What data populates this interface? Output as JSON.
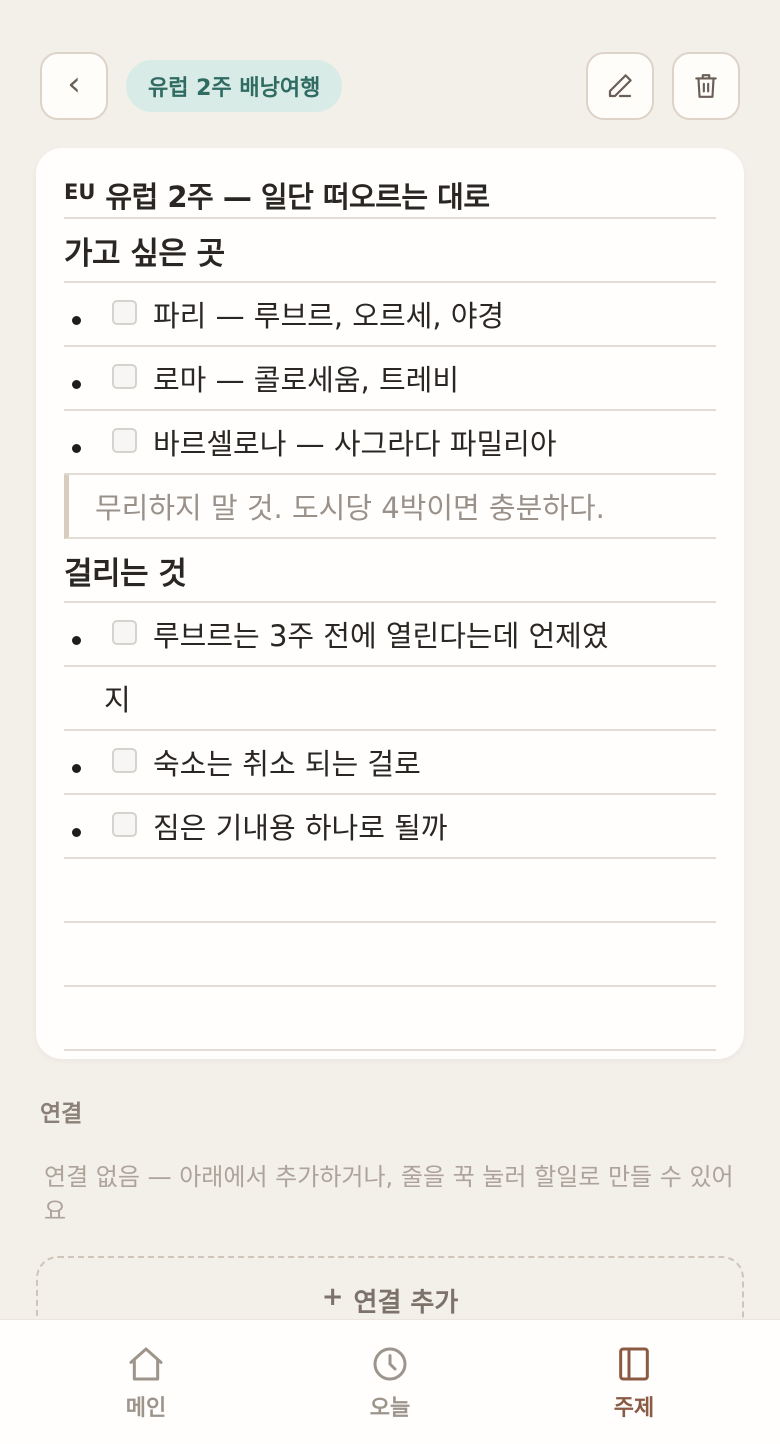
{
  "header": {
    "back_icon": "chevron-left-icon",
    "topic_chip": "유럽 2주 배낭여행",
    "edit_icon": "pencil-icon",
    "delete_icon": "trash-icon"
  },
  "note": {
    "title_badge": "EU",
    "title": "유럽 2주 — 일단 떠오르는 대로",
    "section1_heading": "가고 싶은 곳",
    "section1_items": [
      "파리 — 루브르, 오르세, 야경",
      "로마 — 콜로세움, 트레비",
      "바르셀로나 — 사그라다 파밀리아"
    ],
    "quote": "무리하지 말 것. 도시당 4박이면 충분하다.",
    "section2_heading": "걸리는 것",
    "section2_items": [
      "루브르는 3주 전에 열린다는데 언제였",
      "숙소는 취소 되는 걸로",
      "짐은 기내용 하나로 될까"
    ],
    "section2_item0_wrap": "지"
  },
  "links": {
    "label": "연결",
    "empty_text": "연결 없음 — 아래에서 추가하거나, 줄을 꾹 눌러 할일로 만들 수 있어요",
    "add_plus": "+",
    "add_label": "연결 추가"
  },
  "nav": {
    "items": [
      {
        "label": "메인",
        "icon": "home-icon"
      },
      {
        "label": "오늘",
        "icon": "clock-icon"
      },
      {
        "label": "주제",
        "icon": "notebook-icon"
      }
    ],
    "active_index": 2,
    "active_color": "#8a5a44",
    "inactive_color": "#9d948c"
  },
  "colors": {
    "background": "#f3efe9",
    "chip_bg": "#d8ebe6",
    "chip_text": "#2f6b62"
  }
}
